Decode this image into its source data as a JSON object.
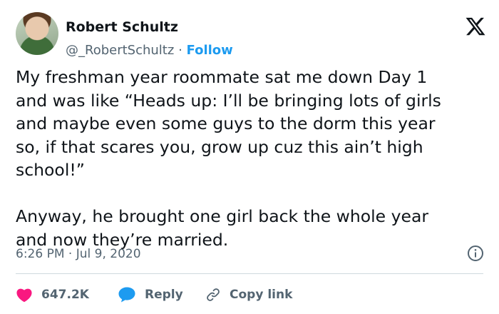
{
  "author": {
    "name": "Robert Schultz",
    "handle": "@_RobertSchultz",
    "separator": "·",
    "follow_label": "Follow"
  },
  "brand_icon": "x-logo-icon",
  "tweet": {
    "text": "My freshman year roommate sat me down Day 1\nand was like “Heads up: I’ll be bringing lots of girls\nand maybe even some guys to the dorm this year\nso, if that scares you, grow up cuz this ain’t high\nschool!”\n\nAnyway, he brought one girl back the whole year\nand now they’re married.",
    "timestamp": "6:26 PM · Jul 9, 2020"
  },
  "actions": {
    "like_count": "647.2K",
    "reply_label": "Reply",
    "copy_link_label": "Copy link"
  },
  "colors": {
    "accent": "#1d9bf0",
    "like": "#f91880",
    "muted": "#536471",
    "text": "#0f1419"
  }
}
